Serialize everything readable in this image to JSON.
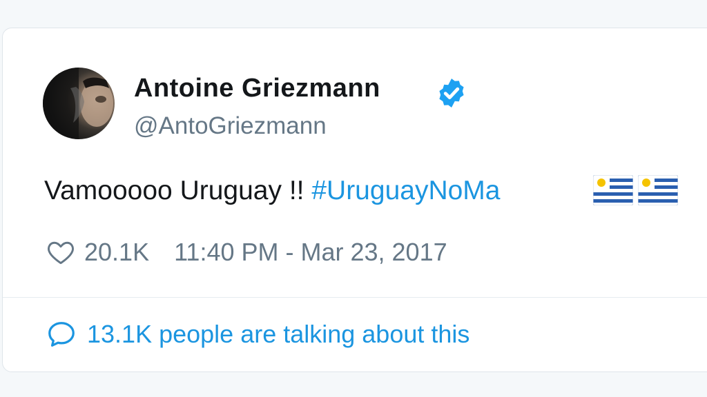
{
  "tweet": {
    "author": {
      "name": "Antoine Griezmann",
      "handle": "@AntoGriezmann",
      "verified_icon": "verified-badge-icon"
    },
    "text": {
      "plain": "Vamooooo Uruguay !! ",
      "hashtag": "#UruguayNoMa",
      "emoji": [
        "uruguay-flag",
        "uruguay-flag"
      ]
    },
    "likes": "20.1K",
    "timestamp": "11:40 PM - Mar 23, 2017",
    "talking_about": "13.1K people are talking about this"
  },
  "colors": {
    "link_blue": "#1b95e0",
    "text_primary": "#14171a",
    "text_secondary": "#657786",
    "verified_blue": "#1da1f2"
  }
}
